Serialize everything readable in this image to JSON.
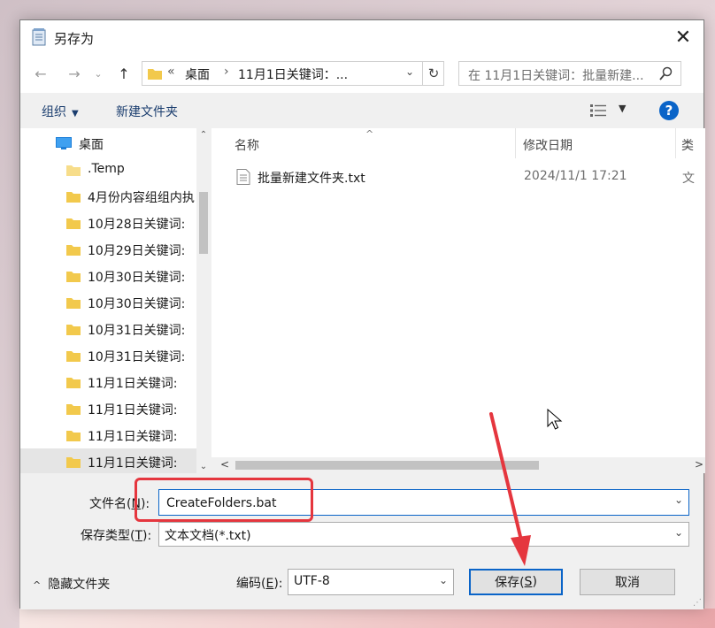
{
  "window": {
    "title": "另存为",
    "close_glyph": "✕"
  },
  "navigation": {
    "back_glyph": "←",
    "forward_glyph": "→",
    "recent_glyph": "⌄",
    "up_glyph": "↑",
    "address_overflow": "«",
    "address_segments": [
      "桌面",
      "11月1日关键词：..."
    ],
    "address_chevron": "›",
    "dropdown_glyph": "⌄",
    "refresh_glyph": "↻",
    "search_placeholder": "在 11月1日关键词：批量新建..."
  },
  "toolbar": {
    "organize_label": "组织",
    "organize_arrow": "▼",
    "new_folder_label": "新建文件夹",
    "view_arrow": "▼",
    "help_label": "?"
  },
  "folder_tree": {
    "items": [
      {
        "label": "桌面",
        "icon": "desktop-icon"
      },
      {
        "label": ".Temp",
        "icon": "folder-icon"
      },
      {
        "label": "4月份内容组组内执",
        "icon": "folder-icon"
      },
      {
        "label": "10月28日关键词:",
        "icon": "folder-icon"
      },
      {
        "label": "10月29日关键词:",
        "icon": "folder-icon"
      },
      {
        "label": "10月30日关键词:",
        "icon": "folder-icon"
      },
      {
        "label": "10月30日关键词:",
        "icon": "folder-icon"
      },
      {
        "label": "10月31日关键词:",
        "icon": "folder-icon"
      },
      {
        "label": "10月31日关键词:",
        "icon": "folder-icon"
      },
      {
        "label": "11月1日关键词:",
        "icon": "folder-icon"
      },
      {
        "label": "11月1日关键词:",
        "icon": "folder-icon"
      },
      {
        "label": "11月1日关键词:",
        "icon": "folder-icon"
      },
      {
        "label": "11月1日关键词:",
        "icon": "folder-icon"
      }
    ],
    "selected_index": 12,
    "scroll_up": "⌃",
    "scroll_down": "⌄"
  },
  "file_list": {
    "columns": [
      "名称",
      "修改日期",
      "类"
    ],
    "sort_indicator": "^",
    "files": [
      {
        "name": "批量新建文件夹.txt",
        "modified": "2024/11/1 17:21",
        "type": "文"
      }
    ],
    "scroll_left": "<",
    "scroll_right": ">"
  },
  "save_form": {
    "filename_label": "文件名(",
    "filename_key": "N",
    "filename_label_end": "):",
    "filename_value": "CreateFolders.bat",
    "filetype_label": "保存类型(",
    "filetype_key": "T",
    "filetype_label_end": "):",
    "filetype_value": "文本文档(*.txt)",
    "dropdown_glyph": "⌄",
    "hide_folders_label": "隐藏文件夹",
    "hide_folders_glyph": "^",
    "encoding_label": "编码(",
    "encoding_key": "E",
    "encoding_label_end": "):",
    "encoding_value": "UTF-8",
    "save_label": "保存(",
    "save_key": "S",
    "save_label_end": ")",
    "cancel_label": "取消"
  },
  "colors": {
    "accent": "#0a64c8",
    "annotation": "#e5363e",
    "folder": "#f2c94c",
    "selected": "#cce4f7"
  }
}
